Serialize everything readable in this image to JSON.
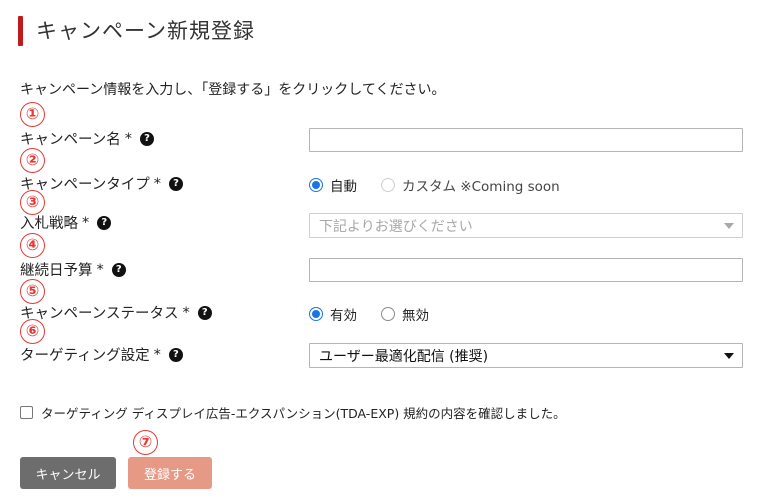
{
  "page": {
    "title": "キャンペーン新規登録",
    "intro": "キャンペーン情報を入力し、「登録する」をクリックしてください。"
  },
  "markers": [
    "①",
    "②",
    "③",
    "④",
    "⑤",
    "⑥",
    "⑦"
  ],
  "fields": {
    "campaign_name": {
      "label": "キャンペーン名",
      "required": "*",
      "value": ""
    },
    "campaign_type": {
      "label": "キャンペーンタイプ",
      "required": "*",
      "options": [
        {
          "label": "自動",
          "selected": true,
          "disabled": false
        },
        {
          "label": "カスタム ※Coming soon",
          "selected": false,
          "disabled": true
        }
      ]
    },
    "bid_strategy": {
      "label": "入札戦略",
      "required": "*",
      "placeholder": "下記よりお選びください"
    },
    "daily_budget": {
      "label": "継続日予算",
      "required": "*",
      "value": ""
    },
    "campaign_status": {
      "label": "キャンペーンステータス",
      "required": "*",
      "options": [
        {
          "label": "有効",
          "selected": true
        },
        {
          "label": "無効",
          "selected": false
        }
      ]
    },
    "targeting": {
      "label": "ターゲティング設定",
      "required": "*",
      "value": "ユーザー最適化配信 (推奨)"
    }
  },
  "agreement": {
    "label": "ターゲティング ディスプレイ広告-エクスパンション(TDA-EXP) 規約の内容を確認しました。",
    "checked": false
  },
  "buttons": {
    "cancel": "キャンセル",
    "submit": "登録する"
  },
  "icons": {
    "help": "question-circle-icon",
    "help_glyph": "?"
  },
  "colors": {
    "accent": "#c01b1b",
    "marker": "#e53935",
    "radio": "#1a73e8",
    "cancel": "#6d6d6d",
    "submit": "#e69a85"
  }
}
